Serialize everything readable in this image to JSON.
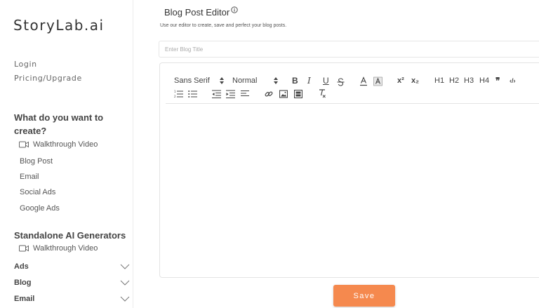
{
  "brand": {
    "logo": "StoryLab.ai"
  },
  "sidebar": {
    "nav": {
      "login": "Login",
      "pricing": "Pricing/Upgrade"
    },
    "create": {
      "title": "What do you want to create?",
      "video": "Walkthrough Video",
      "items": [
        "Blog Post",
        "Email",
        "Social Ads",
        "Google Ads"
      ]
    },
    "standalone": {
      "title": "Standalone AI Generators",
      "video": "Walkthrough Video",
      "accordions": [
        "Ads",
        "Blog",
        "Email"
      ]
    }
  },
  "main": {
    "title": "Blog Post Editor",
    "subtitle": "Use our editor to create, save and perfect your blog posts.",
    "title_placeholder": "Enter Blog Title",
    "toolbar": {
      "font": "Sans Serif",
      "size": "Normal",
      "bold": "B",
      "italic": "I",
      "underline": "U",
      "superscript": "x²",
      "subscript": "x₂",
      "h1": "H1",
      "h2": "H2",
      "h3": "H3",
      "h4": "H4",
      "quote": "❞",
      "code": "‹/›"
    },
    "save": "Save"
  },
  "colors": {
    "accent": "#f5894e",
    "border": "#e4e4e4"
  }
}
